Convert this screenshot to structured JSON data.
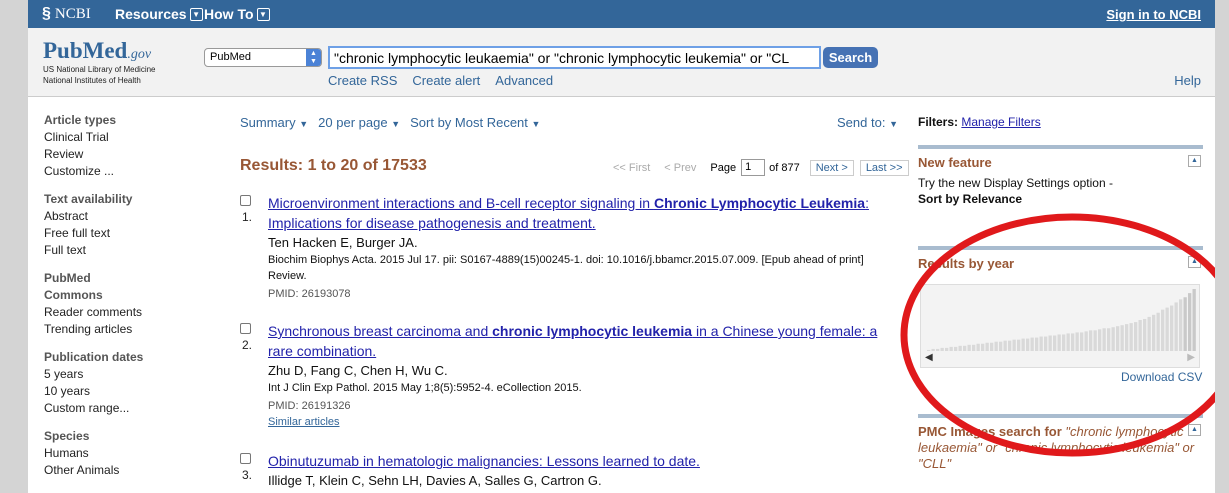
{
  "ncbi": {
    "logo": "NCBI",
    "resources": "Resources",
    "howto": "How To",
    "signin": "Sign in to NCBI"
  },
  "pubmed": {
    "logo_word": "PubMed",
    "logo_gov": ".gov",
    "sub1": "US National Library of Medicine",
    "sub2": "National Institutes of Health",
    "db_value": "PubMed",
    "query": "\"chronic lymphocytic leukaemia\" or \"chronic lymphocytic leukemia\" or \"CL",
    "search_label": "Search",
    "links": [
      "Create RSS",
      "Create alert",
      "Advanced"
    ],
    "help": "Help"
  },
  "sidebar": [
    {
      "head": "Article types",
      "items": [
        "Clinical Trial",
        "Review",
        "Customize ..."
      ]
    },
    {
      "head": "Text availability",
      "items": [
        "Abstract",
        "Free full text",
        "Full text"
      ]
    },
    {
      "head": "PubMed Commons",
      "items": [
        "Reader comments",
        "Trending articles"
      ]
    },
    {
      "head": "Publication dates",
      "items": [
        "5 years",
        "10 years",
        "Custom range..."
      ]
    },
    {
      "head": "Species",
      "items": [
        "Humans",
        "Other Animals"
      ]
    }
  ],
  "toolbar": {
    "summary": "Summary",
    "per_page": "20 per page",
    "sort": "Sort by Most Recent",
    "send_to": "Send to:"
  },
  "results_count": "Results: 1 to 20 of 17533",
  "pager": {
    "first": "<< First",
    "prev": "< Prev",
    "page_label": "Page",
    "page_value": "1",
    "of": "of 877",
    "next": "Next >",
    "last": "Last >>"
  },
  "results": [
    {
      "num": "1.",
      "title_a": "Microenvironment interactions and B-cell receptor signaling in ",
      "title_b": "Chronic Lymphocytic Leukemia",
      "title_c": ": Implications for disease pathogenesis and treatment.",
      "authors": "Ten Hacken E, Burger JA.",
      "cite": "Biochim Biophys Acta. 2015 Jul 17. pii: S0167-4889(15)00245-1. doi: 10.1016/j.bbamcr.2015.07.009. [Epub ahead of print] Review.",
      "pmid": "PMID: 26193078"
    },
    {
      "num": "2.",
      "title_a": "Synchronous breast carcinoma and ",
      "title_b": "chronic lymphocytic leukemia",
      "title_c": " in a Chinese young female: a rare combination.",
      "authors": "Zhu D, Fang C, Chen H, Wu C.",
      "cite": "Int J Clin Exp Pathol. 2015 May 1;8(5):5952-4. eCollection 2015.",
      "pmid": "PMID: 26191326",
      "similar": "Similar articles"
    },
    {
      "num": "3.",
      "title_a": "Obinutuzumab in hematologic malignancies: Lessons learned to date.",
      "authors": "Illidge T, Klein C, Sehn LH, Davies A, Salles G, Cartron G."
    }
  ],
  "right": {
    "filters_label": "Filters:",
    "manage_filters": "Manage Filters",
    "new_feature_head": "New feature",
    "new_feature_text": "Try the new Display Settings option -",
    "new_feature_bold": "Sort by Relevance",
    "results_by_year": "Results by year",
    "download_csv": "Download CSV",
    "pmc_head": "PMC Images search for",
    "pmc_query": "\"chronic lymphocytic leukaemia\" or \"chronic lymphocytic leukemia\" or \"CLL\""
  },
  "chart_data": {
    "type": "bar",
    "values": [
      1,
      2,
      2,
      3,
      3,
      4,
      4,
      5,
      5,
      6,
      6,
      7,
      7,
      8,
      8,
      9,
      9,
      10,
      10,
      11,
      11,
      12,
      12,
      13,
      13,
      14,
      14,
      15,
      15,
      16,
      16,
      17,
      17,
      18,
      18,
      19,
      20,
      20,
      21,
      22,
      22,
      23,
      24,
      25,
      26,
      27,
      28,
      30,
      31,
      33,
      35,
      37,
      40,
      42,
      44,
      47,
      50,
      52,
      56,
      60
    ]
  },
  "colors": {
    "ncbi_bar": "#336699",
    "results_brown": "#985735",
    "annotation_red": "#e0191b"
  }
}
